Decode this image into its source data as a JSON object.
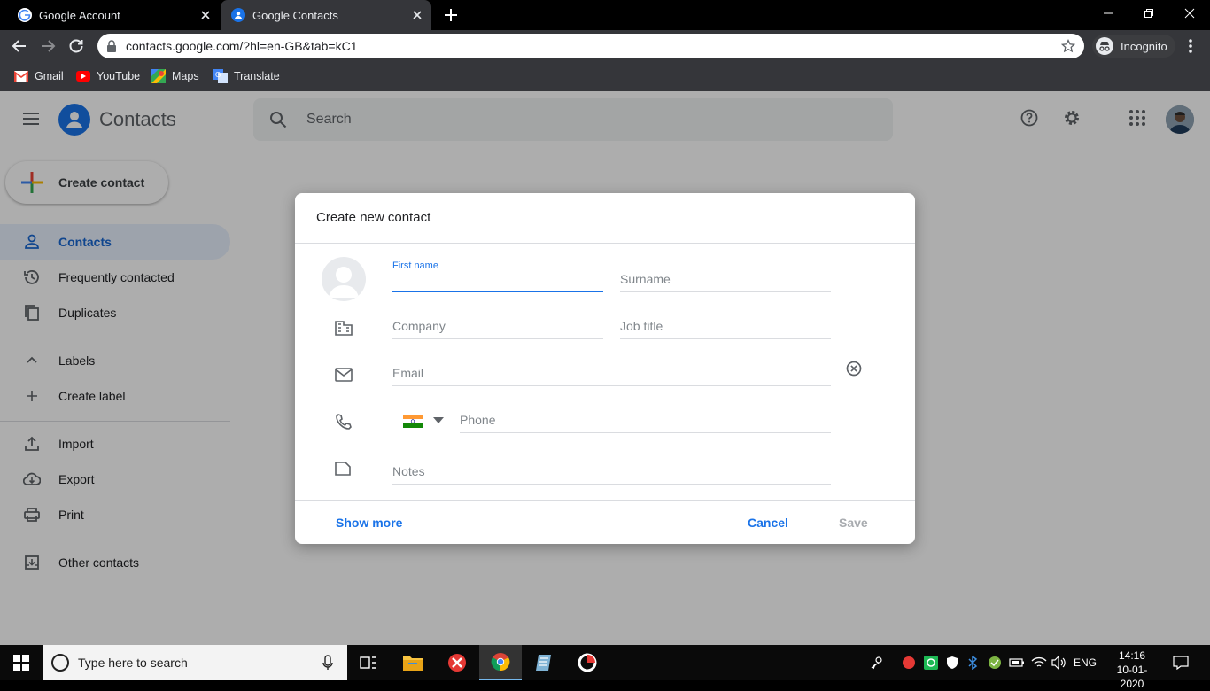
{
  "browser": {
    "tabs": [
      {
        "title": "Google Account",
        "active": false
      },
      {
        "title": "Google Contacts",
        "active": true
      }
    ],
    "url": "contacts.google.com/?hl=en-GB&tab=kC1",
    "profile_label": "Incognito",
    "bookmarks": [
      "Gmail",
      "YouTube",
      "Maps",
      "Translate"
    ]
  },
  "app": {
    "title": "Contacts",
    "search_placeholder": "Search",
    "create_contact_label": "Create contact",
    "nav": {
      "contacts": "Contacts",
      "frequently_contacted": "Frequently contacted",
      "duplicates": "Duplicates",
      "labels": "Labels",
      "create_label": "Create label",
      "import": "Import",
      "export": "Export",
      "print": "Print",
      "other_contacts": "Other contacts"
    }
  },
  "dialog": {
    "title": "Create new contact",
    "first_name_label": "First name",
    "surname_placeholder": "Surname",
    "company_placeholder": "Company",
    "job_title_placeholder": "Job title",
    "email_placeholder": "Email",
    "phone_placeholder": "Phone",
    "notes_placeholder": "Notes",
    "show_more": "Show more",
    "cancel": "Cancel",
    "save": "Save"
  },
  "taskbar": {
    "search_placeholder": "Type here to search",
    "language": "ENG",
    "time": "14:16",
    "date": "10-01-2020"
  },
  "colors": {
    "accent": "#1a73e8",
    "chrome_dark": "#35363a"
  }
}
